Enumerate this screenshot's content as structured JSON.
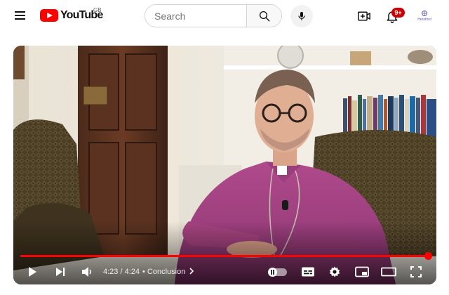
{
  "header": {
    "logo_text": "YouTube",
    "region": "GB",
    "search_placeholder": "Search",
    "notifications_badge": "9+",
    "avatar_text": "Hereford"
  },
  "player": {
    "current_time": "4:23",
    "duration": "4:24",
    "time_separator": "/",
    "chapter_separator": "•",
    "chapter": "Conclusion",
    "progress": 0.996,
    "autoplay": "off"
  },
  "icons": {
    "menu": "hamburger-menu-icon",
    "search": "search-icon",
    "mic": "microphone-icon",
    "create": "create-video-icon",
    "notifications": "bell-icon",
    "play": "play-icon",
    "next": "next-icon",
    "volume": "volume-icon",
    "chapter_arrow": "chevron-right-icon",
    "subtitles": "subtitles-icon",
    "settings": "gear-icon",
    "miniplayer": "miniplayer-icon",
    "theater": "theater-mode-icon",
    "fullscreen": "fullscreen-icon"
  },
  "colors": {
    "brand": "#ff0000",
    "badge": "#cc0000",
    "progress": "#ff0000"
  }
}
